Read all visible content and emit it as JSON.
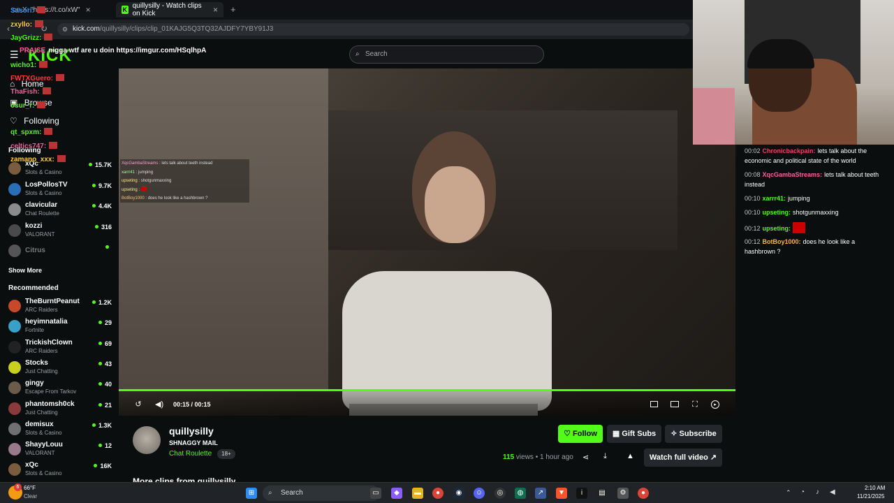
{
  "browser": {
    "tabs": [
      {
        "label": "on X: \"https://t.co/xW\""
      },
      {
        "label": "quillysilly - Watch clips on Kick"
      }
    ],
    "url_domain": "kick.com",
    "url_path": "/quillysilly/clips/clip_01KAJG5Q3TQ32AJDFY7YBY91J3"
  },
  "kick": {
    "logo": "KICK",
    "search_placeholder": "Search"
  },
  "sidebar": {
    "nav": [
      {
        "label": "Home"
      },
      {
        "label": "Browse"
      },
      {
        "label": "Following"
      }
    ],
    "following_header": "Following",
    "following": [
      {
        "name": "xQc",
        "category": "Slots & Casino",
        "viewers": "15.7K",
        "color": "#7a5c3e"
      },
      {
        "name": "LosPollosTV",
        "category": "Slots & Casino",
        "viewers": "9.7K",
        "color": "#2a6fb5"
      },
      {
        "name": "clavicular",
        "category": "Chat Roulette",
        "viewers": "4.4K",
        "color": "#8b8b8b"
      },
      {
        "name": "kozzi",
        "category": "VALORANT",
        "viewers": "316",
        "color": "#4a4a4a"
      },
      {
        "name": "Citrus",
        "category": "",
        "viewers": "",
        "color": "#555"
      }
    ],
    "show_more": "Show More",
    "recommended_header": "Recommended",
    "recommended": [
      {
        "name": "TheBurntPeanut",
        "category": "ARC Raiders",
        "viewers": "1.2K",
        "color": "#c64a2a"
      },
      {
        "name": "heyimnatalia",
        "category": "Fortnite",
        "viewers": "29",
        "color": "#3aa0c8"
      },
      {
        "name": "TrickishClown",
        "category": "ARC Raiders",
        "viewers": "69",
        "color": "#222"
      },
      {
        "name": "Stocks",
        "category": "Just Chatting",
        "viewers": "43",
        "color": "#c8d020"
      },
      {
        "name": "gingy",
        "category": "Escape From Tarkov",
        "viewers": "40",
        "color": "#6b5b4b"
      },
      {
        "name": "phantomsh0ck",
        "category": "Just Chatting",
        "viewers": "21",
        "color": "#8a3a3a"
      },
      {
        "name": "demisux",
        "category": "Slots & Casino",
        "viewers": "1.3K",
        "color": "#707070"
      },
      {
        "name": "ShayyLouu",
        "category": "VALORANT",
        "viewers": "12",
        "color": "#9a7a8a"
      },
      {
        "name": "xQc",
        "category": "Slots & Casino",
        "viewers": "16K",
        "color": "#7a5c3e"
      }
    ]
  },
  "overlay_chat": [
    {
      "user": "Sasori:",
      "color": "#2f9bff"
    },
    {
      "user": "zxyllo:",
      "color": "#ffd23f"
    },
    {
      "user": "JayGrizz:",
      "color": "#53fc18"
    },
    {
      "user": "PRAISE",
      "text": "nigga wtf are u doin https://imgur.com/HSqlhpA",
      "color": "#ff5fa0"
    },
    {
      "user": "wicho1:",
      "color": "#53fc18"
    },
    {
      "user": "FWTXGuero:",
      "color": "#ff4040"
    },
    {
      "user": "ThaFish:",
      "color": "#ff5fa0"
    },
    {
      "user": "osur_r:",
      "color": "#53fc18"
    },
    {
      "user": "qt_spxm:",
      "color": "#53fc18"
    },
    {
      "user": "celtics747:",
      "color": "#ff5fa0"
    },
    {
      "user": "zamano_xxx:",
      "color": "#ffd23f"
    }
  ],
  "video": {
    "chat_overlay": [
      {
        "user": "XqcGambaStreams",
        "text": "lets talk about teeth instead"
      },
      {
        "user": "xarrr41",
        "text": "jumping"
      },
      {
        "user": "upseting",
        "text": "shotgunmaxxing"
      },
      {
        "user": "upseting",
        "text": ""
      },
      {
        "user": "BotBoy1000",
        "text": "does he look like a hashbrown ?"
      }
    ],
    "current_time": "00:15",
    "duration": "00:15",
    "progress": 1.0
  },
  "clip": {
    "channel": "quillysilly",
    "title": "SHNAGGY MAIL",
    "category": "Chat Roulette",
    "rating": "18+",
    "views": "115",
    "views_label": "views",
    "age": "1 hour ago",
    "follow_label": "Follow",
    "gift_label": "Gift Subs",
    "subscribe_label": "Subscribe",
    "watch_full_label": "Watch full video",
    "more_clips": "More clips from quillysilly"
  },
  "right_chat": [
    {
      "time": "00:02",
      "user": "Chronicbackpain:",
      "text": "lets talk about the economic and political state of the world",
      "color": "#ff3b6b"
    },
    {
      "time": "00:08",
      "user": "XqcGambaStreams:",
      "text": "lets talk about teeth instead",
      "color": "#ff5fa0"
    },
    {
      "time": "00:10",
      "user": "xarrr41:",
      "text": "jumping",
      "color": "#53fc18"
    },
    {
      "time": "00:10",
      "user": "upseting:",
      "text": "shotgunmaxxing",
      "color": "#53fc18"
    },
    {
      "time": "00:12",
      "user": "upseting:",
      "text": "",
      "color": "#53fc18"
    },
    {
      "time": "00:12",
      "user": "BotBoy1000:",
      "text": "does he look like a hashbrown ?",
      "color": "#ffb347"
    }
  ],
  "taskbar": {
    "weather_temp": "66°F",
    "weather_desc": "Clear",
    "weather_badge": "6",
    "search_label": "Search",
    "time": "2:10 AM",
    "date": "11/21/2025"
  }
}
